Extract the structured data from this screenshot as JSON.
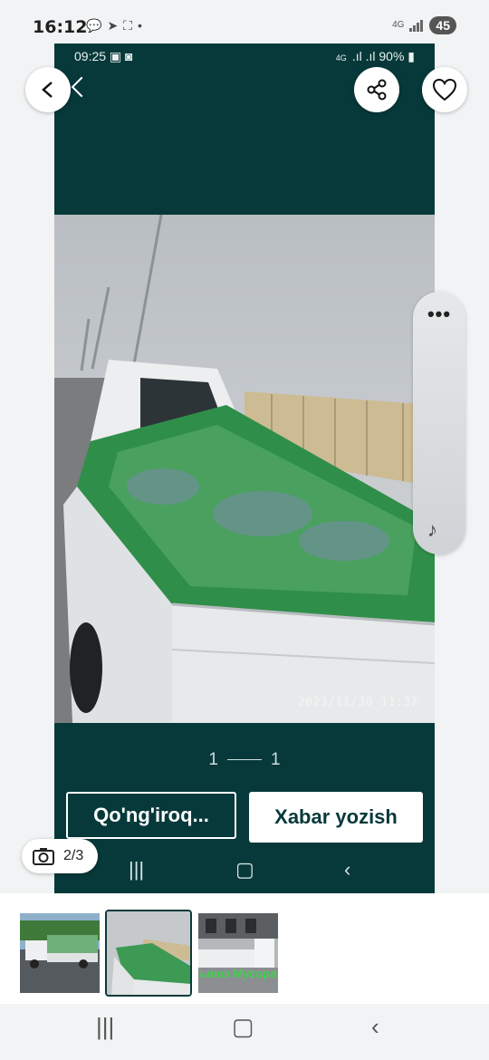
{
  "status_bar": {
    "time": "16:12",
    "network": "4G",
    "battery": "45",
    "icons": [
      "chat-bubble-icon",
      "telegram-icon",
      "screenshot-icon",
      "dot-icon"
    ]
  },
  "inner_screen": {
    "time": "09:25",
    "network": "4G",
    "battery": "90%",
    "photo_timestamp": "2023/11/30 11:37",
    "pager": {
      "current": "1",
      "total": "1"
    },
    "call_button": "Qo'ng'iroq...",
    "message_button": "Xabar yozish",
    "background_color": "#07393a"
  },
  "overlay": {
    "counter": "2/3",
    "side_menu_icon": "more-dots-icon",
    "music_icon": "music-note-icon"
  },
  "thumbnails": [
    {
      "name": "thumb-1",
      "selected": false
    },
    {
      "name": "thumb-2",
      "selected": true
    },
    {
      "name": "thumb-3",
      "selected": false,
      "caption": "ывоз Мусора"
    }
  ],
  "navigation": [
    "recent-apps",
    "home",
    "back"
  ]
}
